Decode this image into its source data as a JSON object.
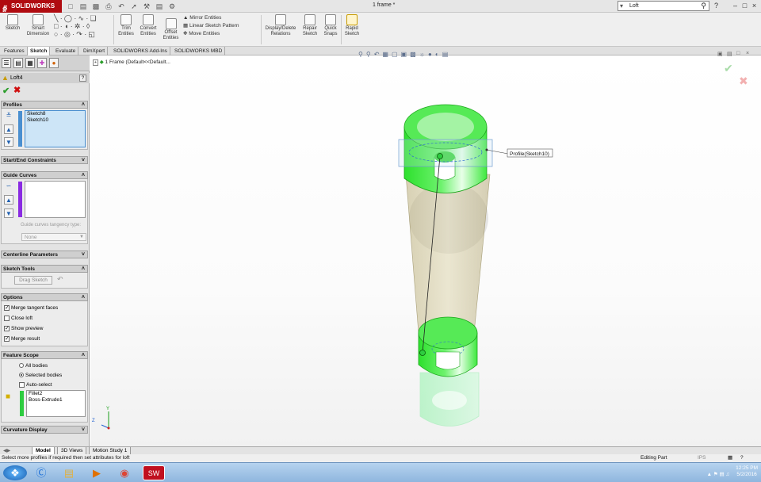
{
  "app": {
    "logo_text": "SOLIDWORKS",
    "document_title": "1 frame *"
  },
  "search": {
    "value": "Loft"
  },
  "ribbon": {
    "sketch": "Sketch",
    "smart_dimension_line1": "Smart",
    "smart_dimension_line2": "Dimension",
    "trim_line1": "Trim",
    "trim_line2": "Entities",
    "convert_line1": "Convert",
    "convert_line2": "Entities",
    "offset_line1": "Offset",
    "offset_line2": "Entities",
    "mirror": "Mirror Entities",
    "linear_pattern": "Linear Sketch Pattern",
    "move": "Move Entities",
    "display_delete_line1": "Display/Delete",
    "display_delete_line2": "Relations",
    "repair_line1": "Repair",
    "repair_line2": "Sketch",
    "quick_snaps_line1": "Quick",
    "quick_snaps_line2": "Snaps",
    "rapid_sketch_line1": "Rapid",
    "rapid_sketch_line2": "Sketch"
  },
  "command_tabs": [
    "Features",
    "Sketch",
    "Evaluate",
    "DimXpert",
    "SOLIDWORKS Add-Ins",
    "SOLIDWORKS MBD"
  ],
  "property_manager": {
    "title": "Loft4",
    "help": "?",
    "profiles": {
      "header": "Profiles",
      "items": [
        "Sketch8",
        "Sketch10"
      ]
    },
    "start_end": {
      "header": "Start/End Constraints"
    },
    "guide_curves": {
      "header": "Guide Curves",
      "tangency_label": "Guide curves tangency type:",
      "tangency_value": "None"
    },
    "centerline": {
      "header": "Centerline Parameters"
    },
    "sketch_tools": {
      "header": "Sketch Tools",
      "drag_sketch": "Drag Sketch"
    },
    "options": {
      "header": "Options",
      "merge_tangent": "Merge tangent faces",
      "close_loft": "Close loft",
      "show_preview": "Show preview",
      "merge_result": "Merge result"
    },
    "feature_scope": {
      "header": "Feature Scope",
      "all_bodies": "All bodies",
      "selected_bodies": "Selected bodies",
      "auto_select": "Auto-select",
      "items": [
        "Fillet2",
        "Boss-Extrude1"
      ]
    },
    "curvature_display": {
      "header": "Curvature Display"
    }
  },
  "viewport": {
    "tree_label": "1 Frame  (Default<<Default...",
    "callout": "Profile(Sketch10)",
    "triad_y": "Y",
    "triad_z": "Z"
  },
  "bottom_tabs": [
    "Model",
    "3D Views",
    "Motion Study 1"
  ],
  "status": {
    "message": "Select more profiles if required then set attributes for loft",
    "mode": "Editing Part",
    "units": "IPS"
  },
  "taskbar": {
    "time": "12:25 PM",
    "date": "5/2/2016"
  },
  "colors": {
    "accent_red": "#b00b10",
    "preview_green": "#3ee83e",
    "body_tan": "#c8be8e",
    "profile_blue": "#4a8fd0"
  }
}
